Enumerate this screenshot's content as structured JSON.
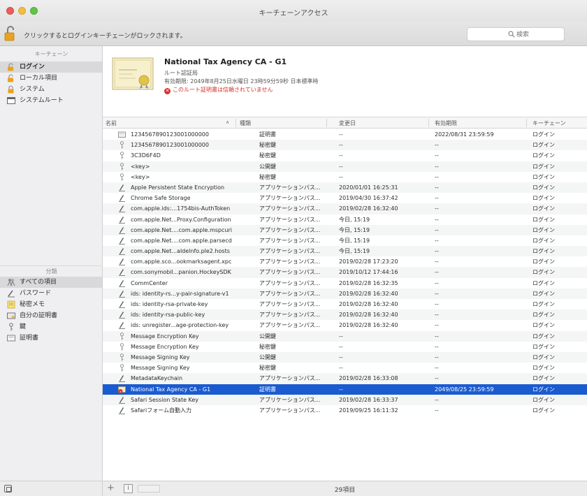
{
  "window": {
    "title": "キーチェーンアクセス"
  },
  "toolbar": {
    "lock_message": "クリックするとログインキーチェーンがロックされます。",
    "search_placeholder": "検索"
  },
  "sidebar": {
    "keychains_header": "キーチェーン",
    "keychains": [
      {
        "label": "ログイン",
        "icon": "keychain-unlocked-icon",
        "selected": true
      },
      {
        "label": "ローカル項目",
        "icon": "keychain-unlocked-icon",
        "selected": false
      },
      {
        "label": "システム",
        "icon": "keychain-locked-icon",
        "selected": false
      },
      {
        "label": "システムルート",
        "icon": "system-root-icon",
        "selected": false
      }
    ],
    "categories_header": "分類",
    "categories": [
      {
        "label": "すべての項目",
        "icon": "all-items-icon",
        "selected": true
      },
      {
        "label": "パスワード",
        "icon": "password-icon",
        "selected": false
      },
      {
        "label": "秘密メモ",
        "icon": "secure-note-icon",
        "selected": false
      },
      {
        "label": "自分の証明書",
        "icon": "my-certificate-icon",
        "selected": false
      },
      {
        "label": "鍵",
        "icon": "key-icon",
        "selected": false
      },
      {
        "label": "証明書",
        "icon": "certificate-icon",
        "selected": false
      }
    ]
  },
  "cert_panel": {
    "name": "National Tax Agency CA - G1",
    "kind": "ルート認証局",
    "expiry": "有効期限: 2049年8月25日水曜日 23時59分59秒 日本標準時",
    "warning": "このルート証明書は信頼されていません"
  },
  "table": {
    "columns": {
      "name": "名前",
      "kind": "種類",
      "modified": "変更日",
      "expires": "有効期限",
      "keychain": "キーチェーン"
    },
    "rows": [
      {
        "icon": "certificate-icon",
        "name": "1234567890123001000000",
        "kind": "証明書",
        "modified": "--",
        "expires": "2022/08/31 23:59:59",
        "keychain": "ログイン"
      },
      {
        "icon": "key-icon",
        "name": "1234567890123001000000",
        "kind": "秘密鍵",
        "modified": "--",
        "expires": "--",
        "keychain": "ログイン"
      },
      {
        "icon": "key-icon",
        "name": "3C3D6F4D",
        "kind": "秘密鍵",
        "modified": "--",
        "expires": "--",
        "keychain": "ログイン"
      },
      {
        "icon": "key-icon",
        "name": "<key>",
        "kind": "公開鍵",
        "modified": "--",
        "expires": "--",
        "keychain": "ログイン"
      },
      {
        "icon": "key-icon",
        "name": "<key>",
        "kind": "秘密鍵",
        "modified": "--",
        "expires": "--",
        "keychain": "ログイン"
      },
      {
        "icon": "password-icon",
        "name": "Apple Persistent State Encryption",
        "kind": "アプリケーションパス...",
        "modified": "2020/01/01 16:25:31",
        "expires": "--",
        "keychain": "ログイン"
      },
      {
        "icon": "password-icon",
        "name": "Chrome Safe Storage",
        "kind": "アプリケーションパス...",
        "modified": "2019/04/30 16:37:42",
        "expires": "--",
        "keychain": "ログイン"
      },
      {
        "icon": "password-icon",
        "name": "com.apple.ids:...1754bis-AuthToken",
        "kind": "アプリケーションパス...",
        "modified": "2019/02/28 16:32:40",
        "expires": "--",
        "keychain": "ログイン"
      },
      {
        "icon": "password-icon",
        "name": "com.apple.Net...Proxy.Configuration",
        "kind": "アプリケーションパス...",
        "modified": "今日, 15:19",
        "expires": "--",
        "keychain": "ログイン"
      },
      {
        "icon": "password-icon",
        "name": "com.apple.Net....com.apple.mspcuri",
        "kind": "アプリケーションパス...",
        "modified": "今日, 15:19",
        "expires": "--",
        "keychain": "ログイン"
      },
      {
        "icon": "password-icon",
        "name": "com.apple.Net....com.apple.parsecd",
        "kind": "アプリケーションパス...",
        "modified": "今日, 15:19",
        "expires": "--",
        "keychain": "ログイン"
      },
      {
        "icon": "password-icon",
        "name": "com.apple.Net...aldelnfo.ple2.hosts",
        "kind": "アプリケーションパス...",
        "modified": "今日, 15:19",
        "expires": "--",
        "keychain": "ログイン"
      },
      {
        "icon": "password-icon",
        "name": "com.apple.sco...ookmarksagent.xpc",
        "kind": "アプリケーションパス...",
        "modified": "2019/02/28 17:23:20",
        "expires": "--",
        "keychain": "ログイン"
      },
      {
        "icon": "password-icon",
        "name": "com.sonymobil...panion.HockeySDK",
        "kind": "アプリケーションパス...",
        "modified": "2019/10/12 17:44:16",
        "expires": "--",
        "keychain": "ログイン"
      },
      {
        "icon": "password-icon",
        "name": "CommCenter",
        "kind": "アプリケーションパス...",
        "modified": "2019/02/28 16:32:35",
        "expires": "--",
        "keychain": "ログイン"
      },
      {
        "icon": "password-icon",
        "name": "ids: identity-rs...y-pair-signature-v1",
        "kind": "アプリケーションパス...",
        "modified": "2019/02/28 16:32:40",
        "expires": "--",
        "keychain": "ログイン"
      },
      {
        "icon": "password-icon",
        "name": "ids: identity-rsa-private-key",
        "kind": "アプリケーションパス...",
        "modified": "2019/02/28 16:32:40",
        "expires": "--",
        "keychain": "ログイン"
      },
      {
        "icon": "password-icon",
        "name": "ids: identity-rsa-public-key",
        "kind": "アプリケーションパス...",
        "modified": "2019/02/28 16:32:40",
        "expires": "--",
        "keychain": "ログイン"
      },
      {
        "icon": "password-icon",
        "name": "ids: unregister...age-protection-key",
        "kind": "アプリケーションパス...",
        "modified": "2019/02/28 16:32:40",
        "expires": "--",
        "keychain": "ログイン"
      },
      {
        "icon": "key-icon",
        "name": "Message Encryption Key",
        "kind": "公開鍵",
        "modified": "--",
        "expires": "--",
        "keychain": "ログイン"
      },
      {
        "icon": "key-icon",
        "name": "Message Encryption Key",
        "kind": "秘密鍵",
        "modified": "--",
        "expires": "--",
        "keychain": "ログイン"
      },
      {
        "icon": "key-icon",
        "name": "Message Signing Key",
        "kind": "公開鍵",
        "modified": "--",
        "expires": "--",
        "keychain": "ログイン"
      },
      {
        "icon": "key-icon",
        "name": "Message Signing Key",
        "kind": "秘密鍵",
        "modified": "--",
        "expires": "--",
        "keychain": "ログイン"
      },
      {
        "icon": "password-icon",
        "name": "MetadataKeychain",
        "kind": "アプリケーションパス...",
        "modified": "2019/02/28 16:33:08",
        "expires": "--",
        "keychain": "ログイン"
      },
      {
        "icon": "certificate-warning-icon",
        "name": "National Tax Agency CA - G1",
        "kind": "証明書",
        "modified": "--",
        "expires": "2049/08/25 23:59:59",
        "keychain": "ログイン",
        "selected": true
      },
      {
        "icon": "password-icon",
        "name": "Safari Session State Key",
        "kind": "アプリケーションパス...",
        "modified": "2019/02/28 16:33:37",
        "expires": "--",
        "keychain": "ログイン"
      },
      {
        "icon": "password-icon",
        "name": "Safariフォーム自動入力",
        "kind": "アプリケーションパス...",
        "modified": "2019/09/25 16:11:32",
        "expires": "--",
        "keychain": "ログイン"
      }
    ]
  },
  "footer": {
    "item_count": "29項目"
  },
  "colors": {
    "selection": "#1b5bd0",
    "warning": "#d6302a",
    "sidebar_bg": "#efeef0"
  }
}
